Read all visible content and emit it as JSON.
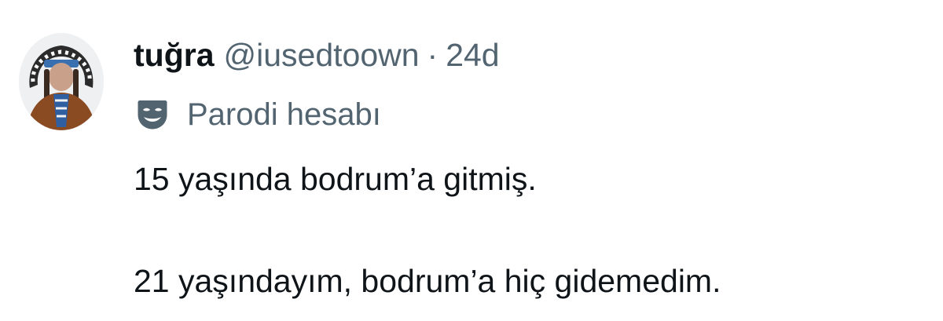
{
  "tweet": {
    "display_name": "tuğra",
    "handle": "@iusedtoown",
    "separator": "·",
    "time": "24d",
    "label": "Parodi hesabı",
    "label_icon": "mask-icon",
    "avatar_icon": "avatar-image",
    "lines": [
      "15 yaşında bodrum’a gitmiş.",
      "21 yaşındayım, bodrum’a hiç gidemedim."
    ]
  },
  "colors": {
    "text_primary": "#0f1419",
    "text_secondary": "#536471",
    "background": "#ffffff"
  }
}
